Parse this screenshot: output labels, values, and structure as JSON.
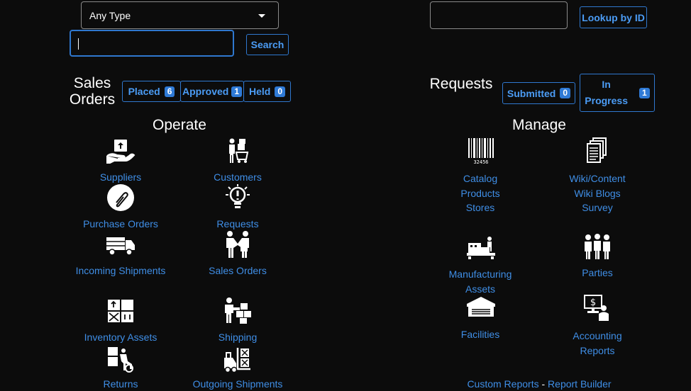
{
  "left": {
    "type_select": {
      "value": "Any Type"
    },
    "search_input": {
      "value": ""
    },
    "search_button": "Search",
    "sales_orders_title": [
      "Sales",
      "Orders"
    ],
    "status_buttons": [
      {
        "label": "Placed",
        "count": "6"
      },
      {
        "label": "Approved",
        "count": "1"
      },
      {
        "label": "Held",
        "count": "0"
      }
    ],
    "section_title": "Operate",
    "items": [
      {
        "label": "Suppliers",
        "icon": "supplier-icon"
      },
      {
        "label": "Customers",
        "icon": "customers-icon"
      },
      {
        "label": "Purchase Orders",
        "icon": "paperclip-icon"
      },
      {
        "label": "Requests",
        "icon": "lightbulb-icon"
      },
      {
        "label": "Incoming Shipments",
        "icon": "truck-icon"
      },
      {
        "label": "Sales Orders",
        "icon": "handshake-icon"
      },
      {
        "label": "Inventory Assets",
        "icon": "boxes-icon"
      },
      {
        "label": "Shipping",
        "icon": "worker-boxes-icon"
      },
      {
        "label": "Returns",
        "icon": "returns-icon"
      },
      {
        "label": "Outgoing Shipments",
        "icon": "forklift-icon"
      }
    ]
  },
  "right": {
    "lookup_input": {
      "value": ""
    },
    "lookup_button": "Lookup by ID",
    "requests_title": "Requests",
    "status_buttons": [
      {
        "label": "Submitted",
        "count": "0"
      },
      {
        "label_line1": "In",
        "label_line2": "Progress",
        "count": "1"
      }
    ],
    "section_title": "Manage",
    "catalog": {
      "links": [
        "Catalog",
        "Products",
        "Stores"
      ],
      "icon": "barcode-icon",
      "barcode_digits": "32456"
    },
    "wiki": {
      "links": [
        "Wiki/Content",
        "Wiki Blogs",
        "Survey"
      ],
      "icon": "documents-icon"
    },
    "manufacturing": {
      "links": [
        "Manufacturing",
        "Assets"
      ],
      "icon": "factory-icon"
    },
    "parties": {
      "links": [
        "Parties"
      ],
      "icon": "people-icon"
    },
    "facilities": {
      "links": [
        "Facilities"
      ],
      "icon": "warehouse-icon"
    },
    "accounting": {
      "links": [
        "Accounting",
        "Reports"
      ],
      "icon": "accounting-icon"
    },
    "footer": {
      "custom_reports": "Custom Reports",
      "separator": " - ",
      "report_builder": "Report Builder"
    }
  },
  "colors": {
    "background": "#0c0c0c",
    "accent": "#3f8ee6",
    "badge": "#2f7ad6",
    "border": "#8a8a8a"
  }
}
